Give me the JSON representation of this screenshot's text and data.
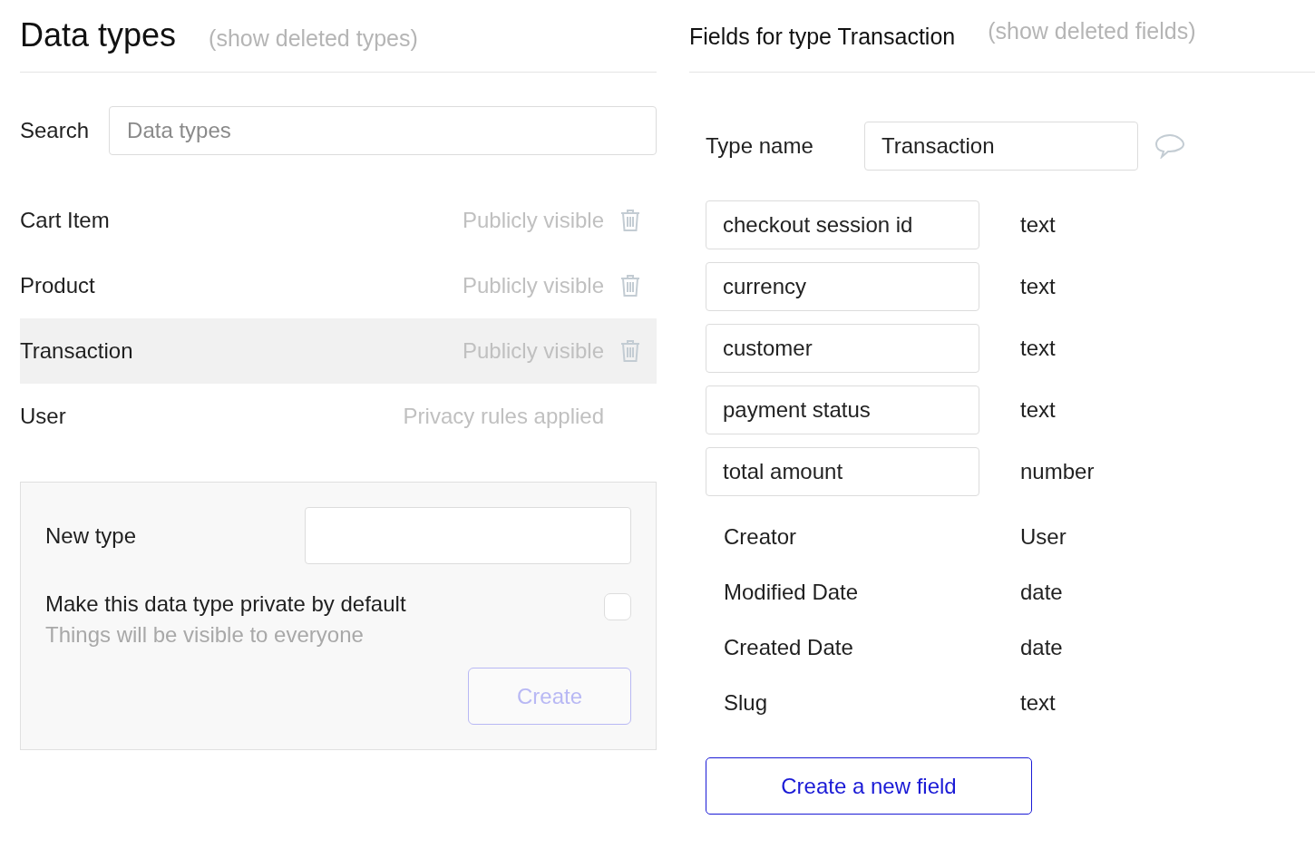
{
  "data_types": {
    "title": "Data types",
    "show_deleted_link": "(show deleted types)",
    "search": {
      "label": "Search",
      "placeholder": "Data types"
    },
    "types": [
      {
        "name": "Cart Item",
        "visibility": "Publicly visible",
        "deletable": true,
        "selected": false
      },
      {
        "name": "Product",
        "visibility": "Publicly visible",
        "deletable": true,
        "selected": false
      },
      {
        "name": "Transaction",
        "visibility": "Publicly visible",
        "deletable": true,
        "selected": true
      },
      {
        "name": "User",
        "visibility": "Privacy rules applied",
        "deletable": false,
        "selected": false
      }
    ],
    "new_type": {
      "label": "New type",
      "private_label": "Make this data type private by default",
      "private_hint": "Things will be visible to everyone",
      "private_checked": false,
      "create_button": "Create",
      "create_disabled": true
    }
  },
  "fields_panel": {
    "title": "Fields for type Transaction",
    "show_deleted_link": "(show deleted fields)",
    "type_name": {
      "label": "Type name",
      "value": "Transaction"
    },
    "fields": [
      {
        "name": "checkout session id",
        "type": "text",
        "kind": "editable"
      },
      {
        "name": "currency",
        "type": "text",
        "kind": "editable"
      },
      {
        "name": "customer",
        "type": "text",
        "kind": "editable"
      },
      {
        "name": "payment status",
        "type": "text",
        "kind": "editable"
      },
      {
        "name": "total amount",
        "type": "number",
        "kind": "editable"
      },
      {
        "name": "Creator",
        "type": "User",
        "kind": "builtin"
      },
      {
        "name": "Modified Date",
        "type": "date",
        "kind": "builtin"
      },
      {
        "name": "Created Date",
        "type": "date",
        "kind": "builtin"
      },
      {
        "name": "Slug",
        "type": "text",
        "kind": "builtin"
      }
    ],
    "new_field_button": "Create a new field"
  }
}
